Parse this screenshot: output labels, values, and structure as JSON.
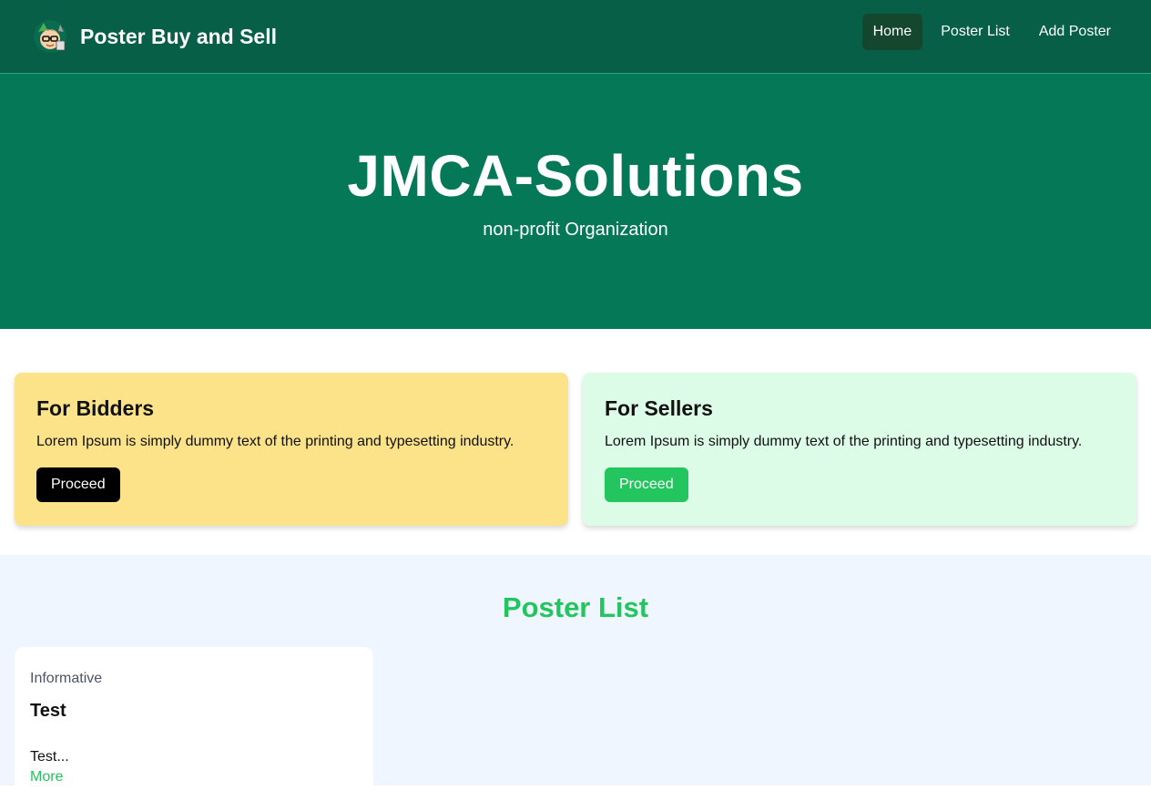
{
  "navbar": {
    "brand_title": "Poster Buy and Sell",
    "logo_icon": "cartoon-avatar-logo",
    "links": [
      {
        "label": "Home",
        "active": true
      },
      {
        "label": "Poster List",
        "active": false
      },
      {
        "label": "Add Poster",
        "active": false
      }
    ]
  },
  "hero": {
    "title": "JMCA-Solutions",
    "subtitle": "non-profit Organization"
  },
  "cards": {
    "bidders": {
      "title": "For Bidders",
      "text": "Lorem Ipsum is simply dummy text of the printing and typesetting industry.",
      "button": "Proceed"
    },
    "sellers": {
      "title": "For Sellers",
      "text": "Lorem Ipsum is simply dummy text of the printing and typesetting industry.",
      "button": "Proceed"
    }
  },
  "poster_list": {
    "title": "Poster List",
    "items": [
      {
        "category": "Informative",
        "title": "Test",
        "description": "Test...",
        "more_label": "More"
      }
    ]
  },
  "colors": {
    "navbar": "#065f46",
    "hero": "#047857",
    "accent_green": "#22c55e",
    "bidders_card": "#fce38a",
    "sellers_card": "#dcfce7",
    "poster_section_bg": "#eff6ff"
  }
}
